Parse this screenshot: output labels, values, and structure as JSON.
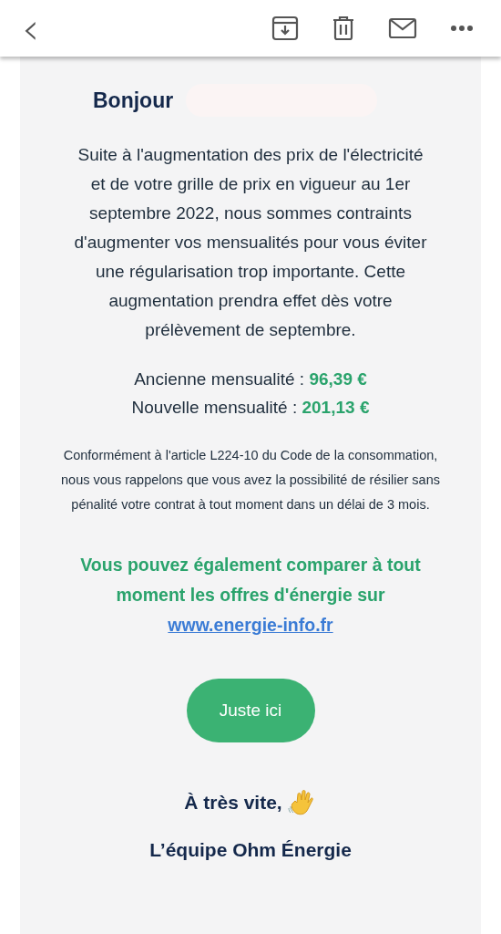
{
  "toolbar": {
    "back": "‹"
  },
  "email": {
    "greeting": "Bonjour",
    "paragraph": "Suite à l'augmentation des prix de l'électricité et de votre grille de prix en vigueur au 1er septembre 2022, nous sommes contraints d'augmenter vos mensualités pour vous éviter une régularisation trop importante. Cette augmentation prendra effet dès votre prélèvement de septembre.",
    "amounts": [
      {
        "label": "Ancienne mensualité : ",
        "value": "96,39 €"
      },
      {
        "label": "Nouvelle mensualité : ",
        "value": "201,13 €"
      }
    ],
    "legal": "Conformément à l'article L224-10 du Code de la consommation, nous vous rappelons que vous avez la possibilité de résilier sans pénalité votre contrat à tout moment dans un délai de 3 mois.",
    "compare": "Vous pouvez également comparer à tout moment les offres d'énergie sur",
    "link": "www.energie-info.fr",
    "button": "Juste ici",
    "closing": "À très vite,",
    "signature": "L’équipe Ohm Énergie"
  }
}
